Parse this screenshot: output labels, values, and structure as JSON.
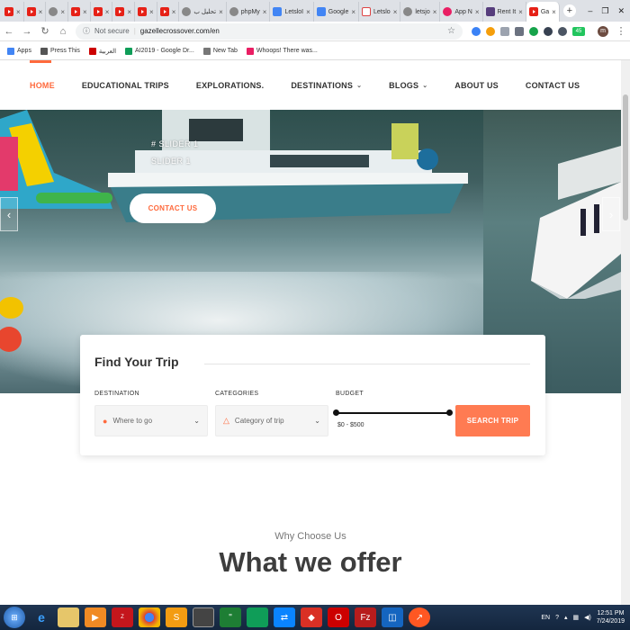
{
  "browser": {
    "tabs": [
      {
        "label": "",
        "icon": "youtube-icon"
      },
      {
        "label": "",
        "icon": "youtube-icon"
      },
      {
        "label": "",
        "icon": "play-icon"
      },
      {
        "label": "",
        "icon": "youtube-icon"
      },
      {
        "label": "",
        "icon": "youtube-icon"
      },
      {
        "label": "",
        "icon": "youtube-icon"
      },
      {
        "label": "",
        "icon": "youtube-icon"
      },
      {
        "label": "",
        "icon": "youtube-icon"
      },
      {
        "label": "تحليل ب",
        "icon": "globe-icon"
      },
      {
        "label": "phpMy",
        "icon": "php-icon"
      },
      {
        "label": "LetsloI",
        "icon": "doc-icon"
      },
      {
        "label": "Google",
        "icon": "doc-icon"
      },
      {
        "label": "Letslo",
        "icon": "gmail-icon"
      },
      {
        "label": "letsjo",
        "icon": "pin-icon"
      },
      {
        "label": "App N",
        "icon": "app-icon"
      },
      {
        "label": "Rent It",
        "icon": "bootstrap-icon"
      },
      {
        "label": "Ga",
        "icon": "map-pin-icon",
        "active": true
      }
    ],
    "address": {
      "security": "Not secure",
      "url": "gazellecrossover.com/en"
    },
    "bookmarks": [
      {
        "label": "Apps",
        "icon": "apps-icon"
      },
      {
        "label": "Press This",
        "icon": "wordpress-icon"
      },
      {
        "label": "العربية",
        "icon": "flag-icon"
      },
      {
        "label": "AI2019 - Google Dr...",
        "icon": "drive-icon"
      },
      {
        "label": "New Tab",
        "icon": "globe-icon"
      },
      {
        "label": "Whoops! There was...",
        "icon": "whoops-icon"
      }
    ],
    "profile_initial": "m",
    "ext_badge": "45"
  },
  "site": {
    "nav": {
      "items": [
        {
          "label": "HOME",
          "active": true,
          "dropdown": false
        },
        {
          "label": "EDUCATIONAL TRIPS",
          "active": false,
          "dropdown": false
        },
        {
          "label": "EXPLORATIONS.",
          "active": false,
          "dropdown": false
        },
        {
          "label": "DESTINATIONS",
          "active": false,
          "dropdown": true
        },
        {
          "label": "BLOGS",
          "active": false,
          "dropdown": true
        },
        {
          "label": "ABOUT US",
          "active": false,
          "dropdown": false
        },
        {
          "label": "CONTACT US",
          "active": false,
          "dropdown": false
        }
      ]
    },
    "hero": {
      "line1": "# SLIDER 1",
      "line2": "SLIDER 1",
      "cta": "CONTACT US",
      "prev": "‹",
      "next": "›"
    },
    "finder": {
      "title": "Find Your Trip",
      "destination_label": "DESTINATION",
      "destination_placeholder": "Where to go",
      "categories_label": "CATEGORIES",
      "categories_placeholder": "Category of trip",
      "budget_label": "BUDGET",
      "budget_range": "$0 - $500",
      "search_label": "SEARCH TRIP"
    },
    "section": {
      "kicker": "Why Choose Us",
      "heading": "What we offer"
    }
  },
  "taskbar": {
    "lang": "EN",
    "time": "12:51 PM",
    "date": "7/24/2019"
  },
  "colors": {
    "accent": "#ff6a3d",
    "button": "#ff7b52"
  }
}
